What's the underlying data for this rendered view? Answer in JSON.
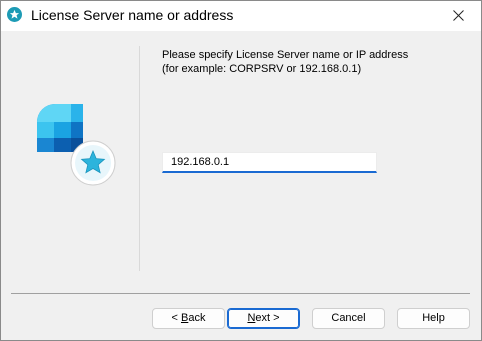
{
  "window": {
    "title": "License Server name or address"
  },
  "prompt": {
    "line1": "Please specify License Server name or IP address",
    "line2": "(for example: CORPSRV or 192.168.0.1)"
  },
  "server_field": {
    "value": "192.168.0.1"
  },
  "buttons": {
    "back": {
      "prefix": "< ",
      "accel": "B",
      "rest": "ack"
    },
    "next": {
      "accel": "N",
      "rest": "ext >"
    },
    "cancel": "Cancel",
    "help": "Help"
  },
  "colors": {
    "accent": "#1a6ad2",
    "app_icon": "#1d9bb5"
  }
}
